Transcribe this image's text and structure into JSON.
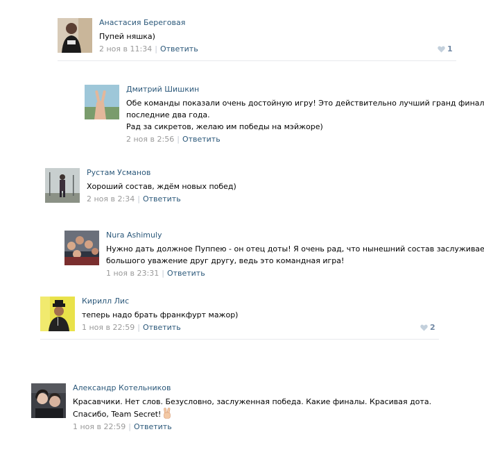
{
  "comments": [
    {
      "author": "Анастасия Береговая",
      "text_lines": [
        "Пупей няшка)"
      ],
      "date": "2 ноя в 11:34",
      "reply": "Ответить",
      "likes": "1"
    },
    {
      "author": "Дмитрий Шишкин",
      "text_lines": [
        "Обе команды показали очень достойную игру! Это действительно лучший гранд финал за",
        "последние два года.",
        "Рад за сикретов, желаю им победы на мэйжоре)"
      ],
      "date": "2 ноя в 2:56",
      "reply": "Ответить"
    },
    {
      "author": "Рустам Усманов",
      "text_lines": [
        "Хороший состав, ждём новых побед)"
      ],
      "date": "2 ноя в 2:34",
      "reply": "Ответить"
    },
    {
      "author": "Nura Ashimuly",
      "text_lines": [
        "Нужно дать должное Пуппею - он отец доты! Я очень рад, что нынешний состав заслуживает",
        "большого уважение друг другу, ведь это командная игра!"
      ],
      "date": "1 ноя в 23:31",
      "reply": "Ответить"
    },
    {
      "author": "Кирилл Лис",
      "text_lines": [
        "теперь надо брать франкфурт мажор)"
      ],
      "date": "1 ноя в 22:59",
      "reply": "Ответить",
      "likes": "2"
    },
    {
      "author": "Александр Котельников",
      "text_lines": [
        "Красавчики. Нет слов. Безусловно, заслуженная победа. Какие финалы. Красивая дота.",
        "Спасибо, Team Secret!"
      ],
      "date": "1 ноя в 22:59",
      "reply": "Ответить"
    }
  ],
  "icons": {
    "like": "heart-icon",
    "emoji": "victory-hand-emoji"
  },
  "colors": {
    "link": "#2b587a",
    "meta": "#999999",
    "like": "#6f87a3",
    "divider": "#e7eaed"
  }
}
